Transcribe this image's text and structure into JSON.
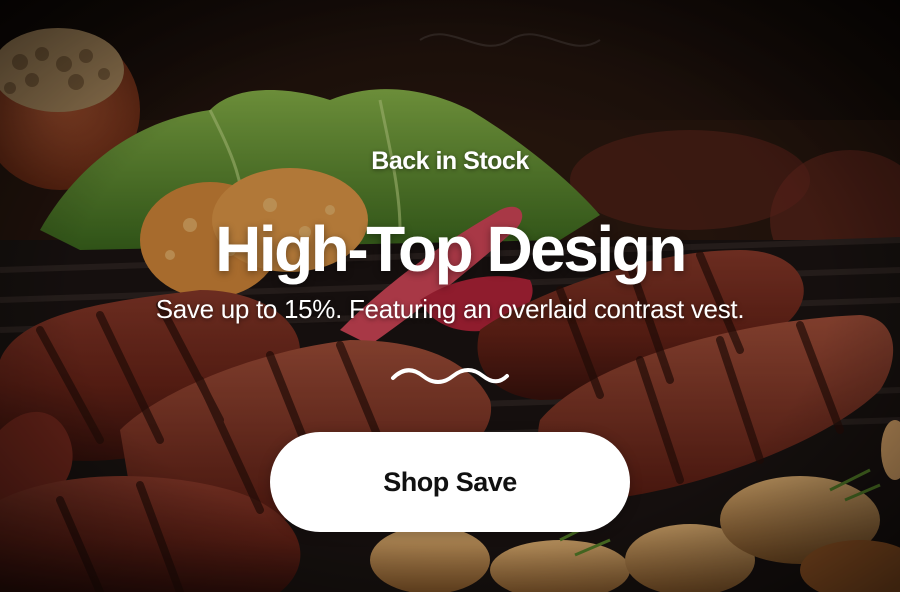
{
  "hero": {
    "image_icon": "grilled-steak-food-photo",
    "eyebrow": "Back in Stock",
    "title": "High-Top Design",
    "subtitle": "Save up to 15%. Featuring an overlaid contrast vest.",
    "divider_icon": "wave-divider-icon",
    "cta_label": "Shop Save"
  },
  "colors": {
    "text": "#ffffff",
    "button_bg": "#ffffff",
    "button_text": "#111111"
  }
}
